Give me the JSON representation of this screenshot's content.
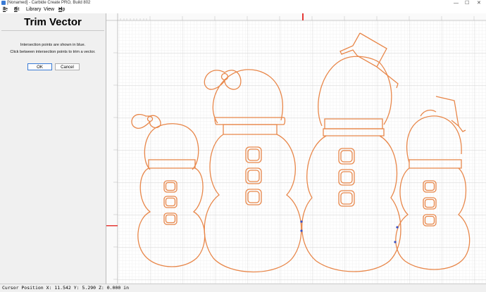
{
  "window": {
    "title": "[Nonamed] - Carbide Create PRO, Build 802",
    "controls": [
      "—",
      "☐",
      "✕"
    ]
  },
  "menu": [
    {
      "label": "File",
      "u": "F",
      "rest": "ile"
    },
    {
      "label": "Edit",
      "u": "E",
      "rest": "dit"
    },
    {
      "label": "Library",
      "u": "",
      "rest": "Library"
    },
    {
      "label": "View",
      "u": "",
      "rest": "View"
    },
    {
      "label": "Help",
      "u": "H",
      "rest": "elp"
    }
  ],
  "panel": {
    "title": "Trim Vector",
    "line1": "Intersection points are shown in blue.",
    "line2": "Click between intersection points to trim a vector.",
    "ok_label": "OK",
    "cancel_label": "Cancel"
  },
  "status": {
    "text": "Cursor Position X: 11.542 Y: 5.290 Z: 0.000 in"
  },
  "colors": {
    "vector": "#e8874a",
    "intersection": "#3b52c4",
    "origin_marker": "#e53935",
    "grid_minor": "#e4e4e4",
    "grid_major": "#cfcfcf"
  }
}
